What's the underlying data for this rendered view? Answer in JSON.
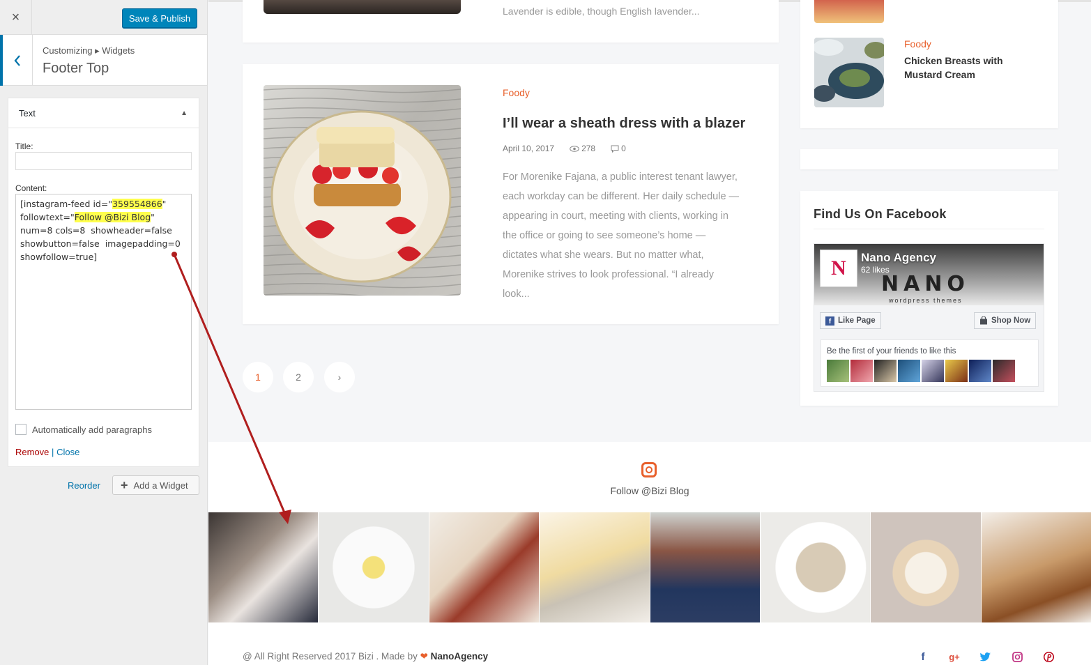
{
  "customizer": {
    "close_label": "×",
    "publish_label": "Save & Publish",
    "breadcrumb": "Customizing ▸ Widgets",
    "section_title": "Footer Top",
    "widget": {
      "name": "Text",
      "title_label": "Title:",
      "title_value": "",
      "content_label": "Content:",
      "content_parts": {
        "p1": "[instagram-feed id=\"",
        "id": "359554866",
        "p2": "\"\nfollowtext=\"",
        "follow": "Follow @Bizi Blog",
        "p3": "\"\nnum=8 cols=8  showheader=false\nshowbutton=false  imagepadding=0\nshowfollow=true]"
      },
      "auto_paragraphs_label": "Automatically add paragraphs",
      "auto_paragraphs_checked": false,
      "remove_label": "Remove",
      "separator": "|",
      "close_link_label": "Close"
    },
    "reorder_label": "Reorder",
    "add_widget_label": "Add a Widget"
  },
  "preview": {
    "prev_excerpt": "Lavender is edible, though English lavender...",
    "post": {
      "category": "Foody",
      "title": "I’ll wear a sheath dress with a blazer",
      "date": "April 10, 2017",
      "views": "278",
      "comments": "0",
      "excerpt": "For Morenike Fajana, a public interest tenant lawyer, each workday can be different. Her daily schedule — appearing in court, meeting with clients, working in the office or going to see someone’s home — dictates what she wears. But no matter what, Morenike strives to look professional. “I already look..."
    },
    "pagination": {
      "page1": "1",
      "page2": "2",
      "next": "›",
      "current": "1"
    },
    "sidebar_post": {
      "category": "Foody",
      "title": "Chicken Breasts with Mustard Cream"
    },
    "facebook": {
      "heading": "Find Us On Facebook",
      "page_name": "Nano Agency",
      "likes": "62 likes",
      "brand": "NANO",
      "brand_sub": "wordpress themes",
      "logo_letter": "N",
      "like_button": "Like Page",
      "shop_button": "Shop Now",
      "friends_text": "Be the first of your friends to like this"
    },
    "instagram": {
      "follow_text": "Follow @Bizi Blog"
    },
    "footer": {
      "copyright_prefix": "@ All Right Reserved 2017 Bizi . Made by",
      "agency": "NanoAgency",
      "socials": [
        "facebook-icon",
        "google-plus-icon",
        "twitter-icon",
        "instagram-icon",
        "pinterest-icon"
      ]
    }
  },
  "colors": {
    "accent": "#e8602c",
    "wp_blue": "#0085ba",
    "highlight": "#ffff4d",
    "annotation_arrow": "#b01e1e"
  }
}
